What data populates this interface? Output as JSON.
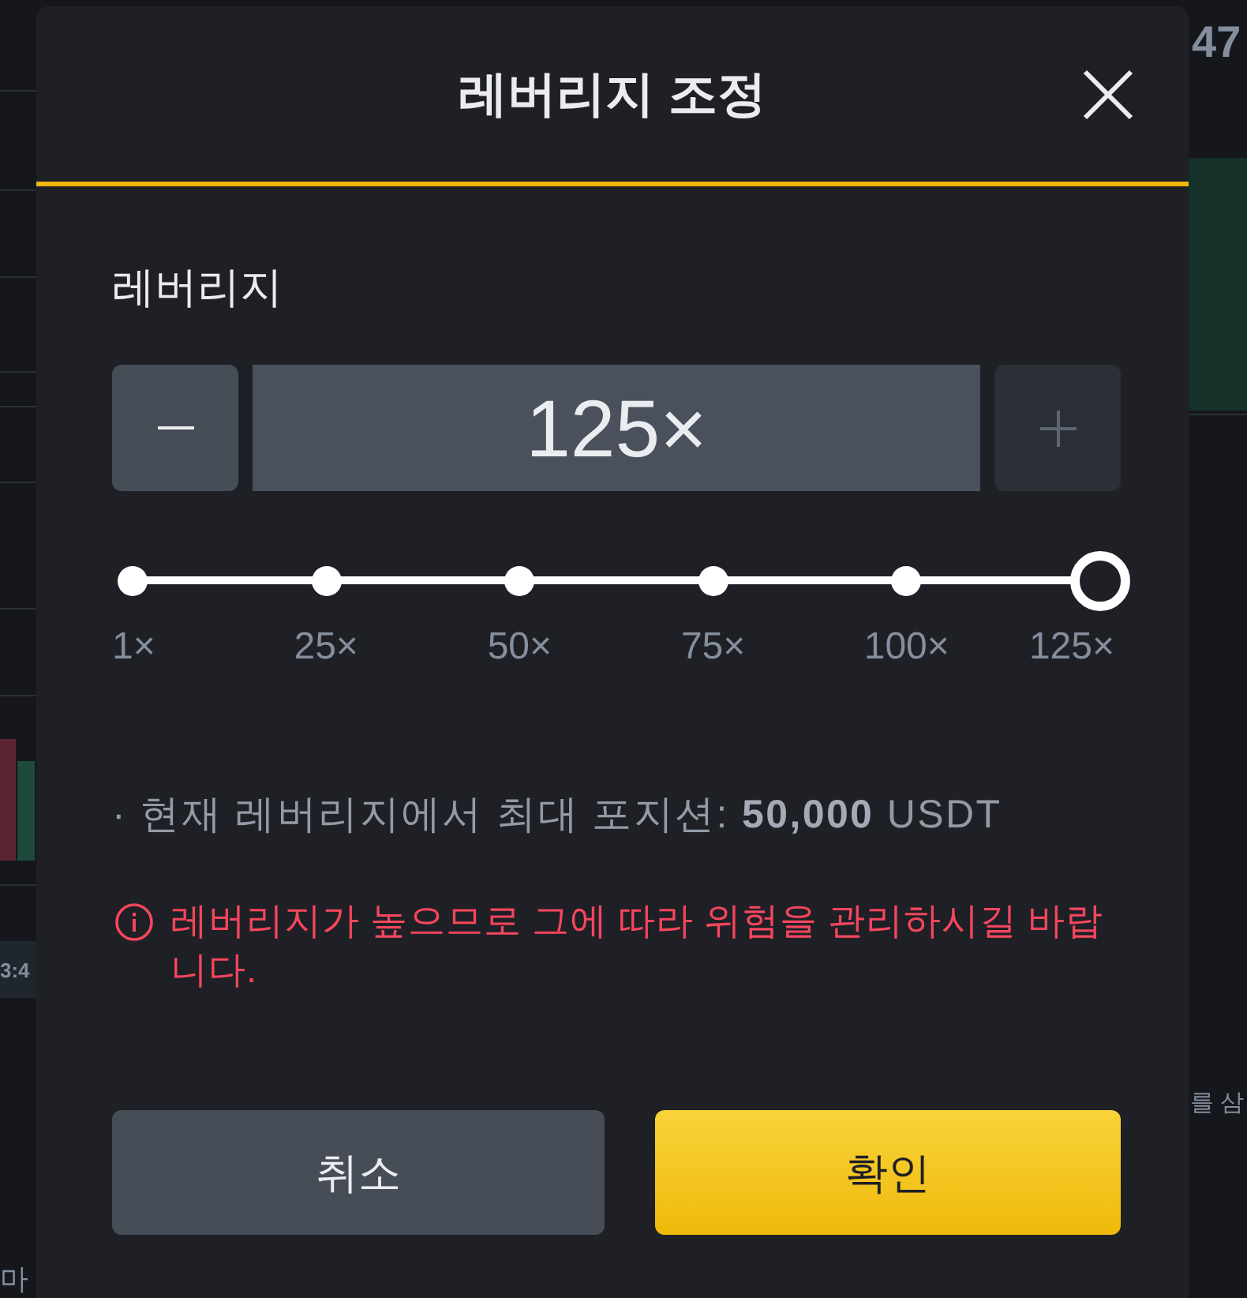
{
  "background": {
    "left_texts": [
      "3:4",
      "마"
    ],
    "right_texts": [
      "47",
      "를 삼"
    ]
  },
  "dialog": {
    "title": "레버리지 조정",
    "leverage": {
      "label": "레버리지",
      "value": "125×",
      "decrease": {
        "disabled": false
      },
      "increase": {
        "disabled": true
      },
      "slider": {
        "level": 1,
        "marks": [
          "1×",
          "25×",
          "50×",
          "75×",
          "100×",
          "125×"
        ]
      }
    },
    "max_position": "· 현재 레버리지에서 최대 포지션: **50,000** USDT",
    "warning": "레버리지가 높으므로 그에 따라 위험을 관리하시길 바랍니다.",
    "buttons": [
      {
        "label": "취소",
        "kind": "secondary"
      },
      {
        "label": "확인",
        "kind": "primary"
      }
    ]
  }
}
